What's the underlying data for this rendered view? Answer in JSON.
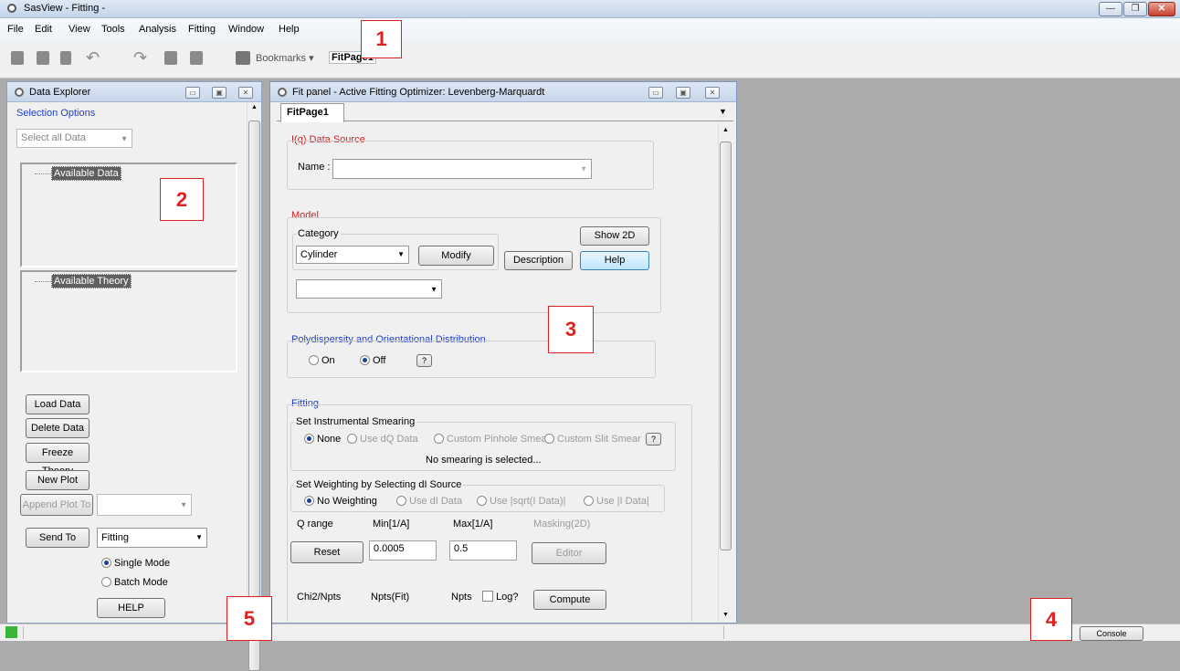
{
  "window": {
    "title": "SasView  - Fitting -"
  },
  "menu": [
    "File",
    "Edit",
    "View",
    "Tools",
    "Analysis",
    "Fitting",
    "Window",
    "Help"
  ],
  "toolbar": {
    "bookmarks": "Bookmarks ▾",
    "fitpage_tab": "FitPage1"
  },
  "callouts": {
    "c1": "1",
    "c2": "2",
    "c3": "3",
    "c4": "4",
    "c5": "5"
  },
  "data_explorer": {
    "title": "Data Explorer",
    "selection_options": "Selection Options",
    "select_all": "Select all Data",
    "available_data": "Available Data",
    "available_theory": "Available Theory",
    "load_data": "Load Data",
    "delete_data": "Delete Data",
    "freeze_theory": "Freeze Theory",
    "new_plot": "New Plot",
    "append_plot": "Append Plot To",
    "send_to": "Send To",
    "send_target": "Fitting",
    "single_mode": "Single Mode",
    "batch_mode": "Batch Mode",
    "help": "HELP"
  },
  "fit_panel": {
    "title": "Fit panel - Active Fitting Optimizer: Levenberg-Marquardt",
    "tab": "FitPage1",
    "data_source": "I(q) Data Source",
    "name_label": "Name :",
    "model": "Model",
    "category": "Category",
    "category_value": "Cylinder",
    "modify": "Modify",
    "description": "Description",
    "show2d": "Show 2D",
    "help": "Help",
    "poly_title": "Polydispersity and Orientational Distribution",
    "on": "On",
    "off": "Off",
    "qmark": "?",
    "fitting": "Fitting",
    "smearing_title": "Set Instrumental Smearing",
    "smear_none": "None",
    "smear_dq": "Use dQ Data",
    "smear_pinhole": "Custom Pinhole Smear",
    "smear_slit": "Custom Slit Smear",
    "no_smearing": "No smearing is selected...",
    "weighting_title": "Set Weighting by Selecting dI Source",
    "w_none": "No Weighting",
    "w_di": "Use dI Data",
    "w_sqrt": "Use |sqrt(I Data)|",
    "w_i": "Use |I Data|",
    "qrange": "Q range",
    "min_label": "Min[1/A]",
    "max_label": "Max[1/A]",
    "masking": "Masking(2D)",
    "reset": "Reset",
    "min_value": "0.0005",
    "max_value": "0.5",
    "editor": "Editor",
    "chi2": "Chi2/Npts",
    "npts_fit": "Npts(Fit)",
    "npts": "Npts",
    "log": "Log?",
    "compute": "Compute"
  },
  "status": {
    "console": "Console"
  }
}
